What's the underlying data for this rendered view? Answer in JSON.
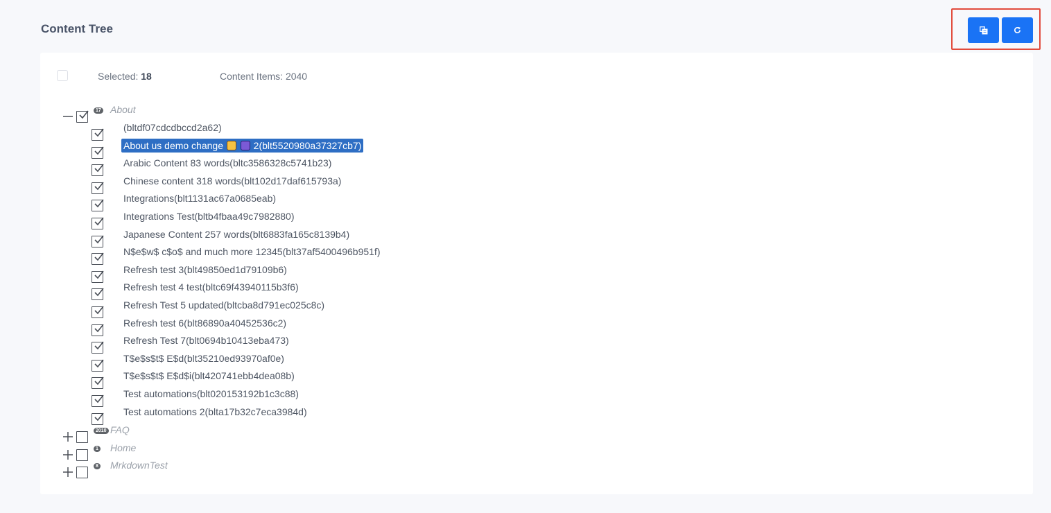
{
  "header": {
    "title": "Content Tree"
  },
  "toolbar": {
    "copy_icon": "copy-icon",
    "refresh_icon": "refresh-icon",
    "accent": "#1a73f5",
    "highlight_color": "#e24b3c"
  },
  "summary": {
    "selected_label": "Selected:",
    "selected_count": "18",
    "items_label": "Content Items:",
    "items_count": "2040"
  },
  "tree": {
    "groups": [
      {
        "name": "About",
        "count": "17",
        "expanded": true,
        "checked": true
      },
      {
        "name": "FAQ",
        "count": "2010",
        "expanded": false,
        "checked": false
      },
      {
        "name": "Home",
        "count": "1",
        "expanded": false,
        "checked": false
      },
      {
        "name": "MrkdownTest",
        "count": "8",
        "expanded": false,
        "checked": false
      }
    ],
    "about_items": [
      {
        "label": "(bltdf07cdcdbccd2a62)",
        "selected": false
      },
      {
        "label_pre": "About us demo change ",
        "label_post": " 2(blt5520980a37327cb7)",
        "selected": true,
        "emojis": [
          "hands-emoji",
          "tickets-emoji"
        ]
      },
      {
        "label": "Arabic Content 83 words(bltc3586328c5741b23)",
        "selected": false
      },
      {
        "label": "Chinese content 318 words(blt102d17daf615793a)",
        "selected": false
      },
      {
        "label": "Integrations(blt1131ac67a0685eab)",
        "selected": false
      },
      {
        "label": "Integrations Test(bltb4fbaa49c7982880)",
        "selected": false
      },
      {
        "label": "Japanese Content 257 words(blt6883fa165c8139b4)",
        "selected": false
      },
      {
        "label": "N$e$w$ c$o$ and much more 12345(blt37af5400496b951f)",
        "selected": false
      },
      {
        "label": "Refresh test 3(blt49850ed1d79109b6)",
        "selected": false
      },
      {
        "label": "Refresh test 4 test(bltc69f43940115b3f6)",
        "selected": false
      },
      {
        "label": "Refresh Test 5 updated(bltcba8d791ec025c8c)",
        "selected": false
      },
      {
        "label": "Refresh test 6(blt86890a40452536c2)",
        "selected": false
      },
      {
        "label": "Refresh Test 7(blt0694b10413eba473)",
        "selected": false
      },
      {
        "label": "T$e$s$t$ E$d(blt35210ed93970af0e)",
        "selected": false
      },
      {
        "label": "T$e$s$t$ E$d$i(blt420741ebb4dea08b)",
        "selected": false
      },
      {
        "label": "Test automations(blt020153192b1c3c88)",
        "selected": false
      },
      {
        "label": "Test automations 2(blta17b32c7eca3984d)",
        "selected": false
      }
    ]
  }
}
